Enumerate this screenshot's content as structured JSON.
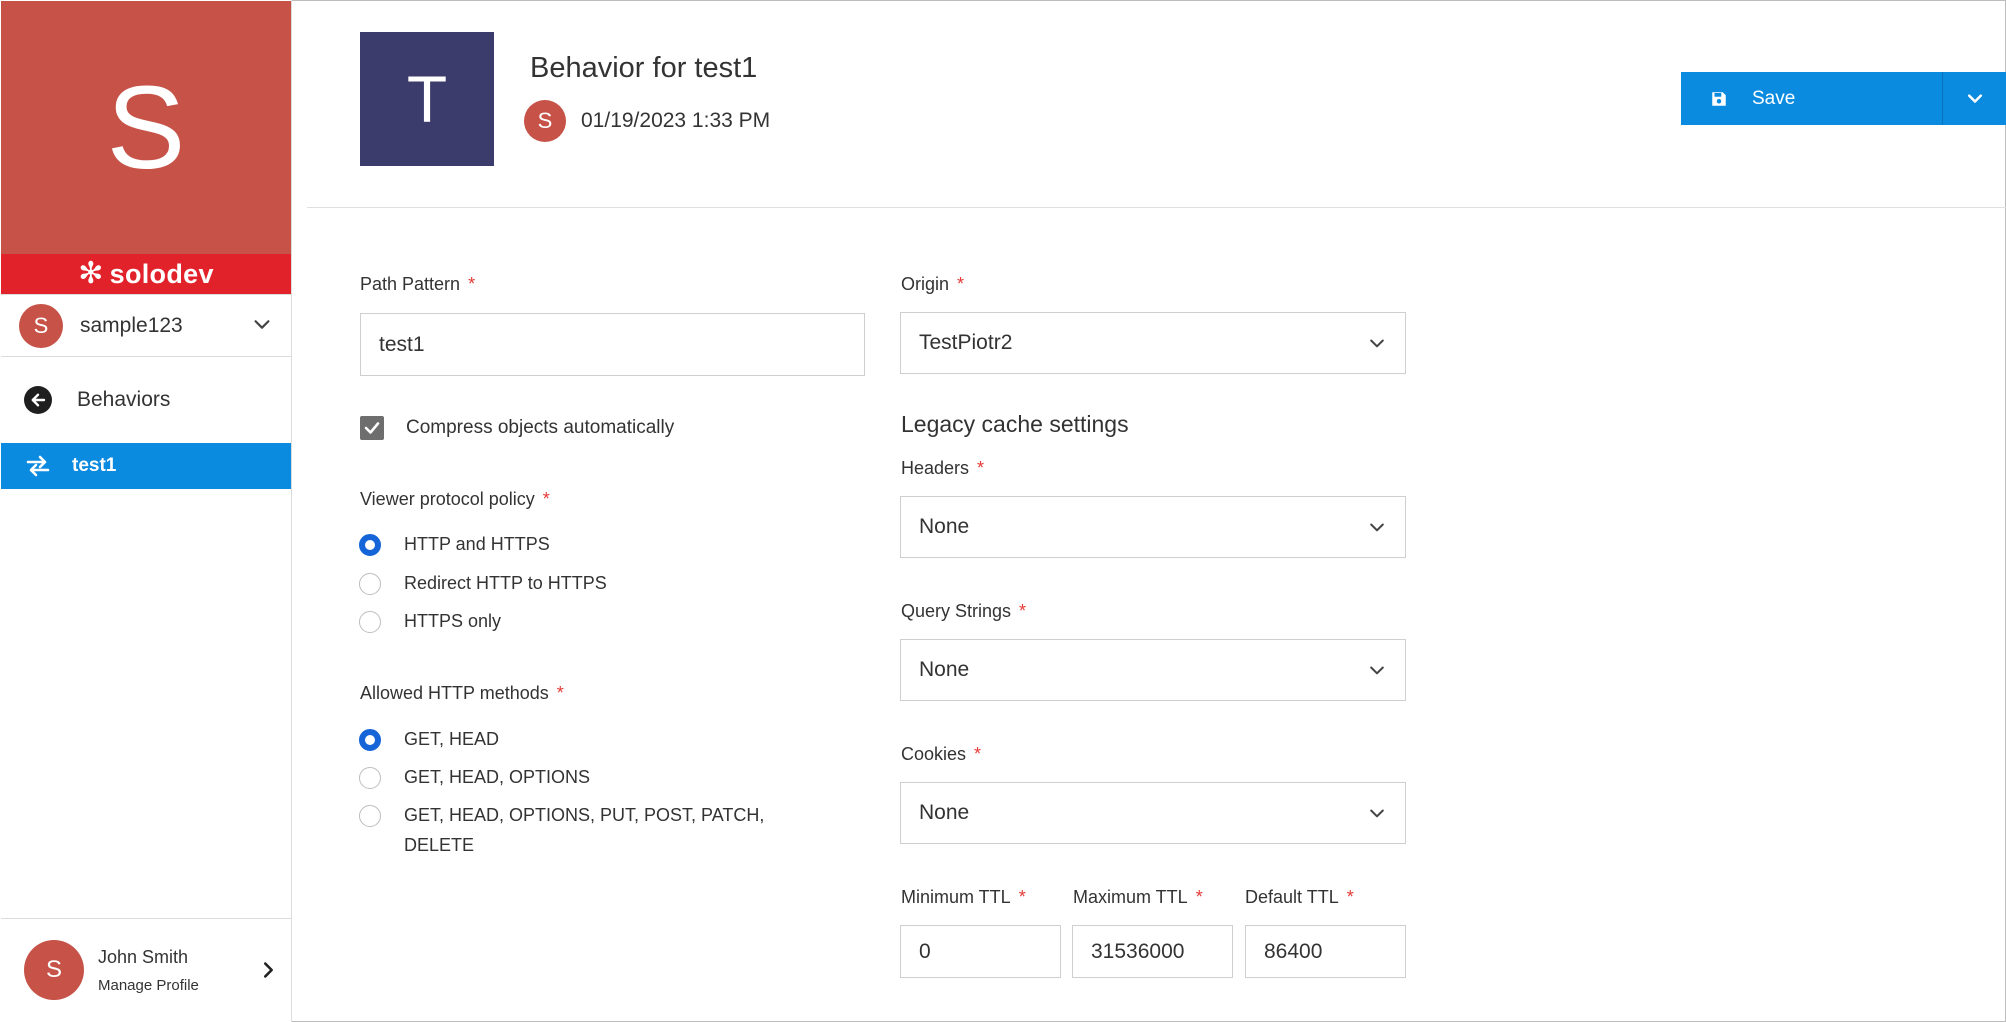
{
  "sidebar": {
    "site_initial": "S",
    "brand": "solodev",
    "site_selector": {
      "initial": "S",
      "name": "sample123"
    },
    "back_label": "Behaviors",
    "active_item": {
      "label": "test1"
    },
    "profile": {
      "initial": "S",
      "name": "John Smith",
      "link": "Manage Profile"
    }
  },
  "header": {
    "square_initial": "T",
    "title": "Behavior for test1",
    "meta_initial": "S",
    "date": "01/19/2023 1:33 PM",
    "save_label": "Save"
  },
  "form": {
    "path_pattern": {
      "label": "Path Pattern",
      "value": "test1"
    },
    "compress": {
      "label": "Compress objects automatically",
      "checked": true
    },
    "viewer_policy": {
      "label": "Viewer protocol policy",
      "options": [
        "HTTP and HTTPS",
        "Redirect HTTP to HTTPS",
        "HTTPS only"
      ],
      "selected": 0
    },
    "allowed_methods": {
      "label": "Allowed HTTP methods",
      "options": [
        "GET, HEAD",
        "GET, HEAD, OPTIONS",
        "GET, HEAD, OPTIONS, PUT, POST, PATCH, DELETE"
      ],
      "selected": 0
    },
    "origin": {
      "label": "Origin",
      "value": "TestPiotr2"
    },
    "legacy_heading": "Legacy cache settings",
    "headers": {
      "label": "Headers",
      "value": "None"
    },
    "query_strings": {
      "label": "Query Strings",
      "value": "None"
    },
    "cookies": {
      "label": "Cookies",
      "value": "None"
    },
    "min_ttl": {
      "label": "Minimum TTL",
      "value": "0"
    },
    "max_ttl": {
      "label": "Maximum TTL",
      "value": "31536000"
    },
    "default_ttl": {
      "label": "Default TTL",
      "value": "86400"
    },
    "required_mark": "*"
  },
  "colors": {
    "accent": "#0b8be0",
    "avatar": "#c65248",
    "brand": "#e2222a",
    "required": "#e53935",
    "radio": "#1565d8"
  }
}
